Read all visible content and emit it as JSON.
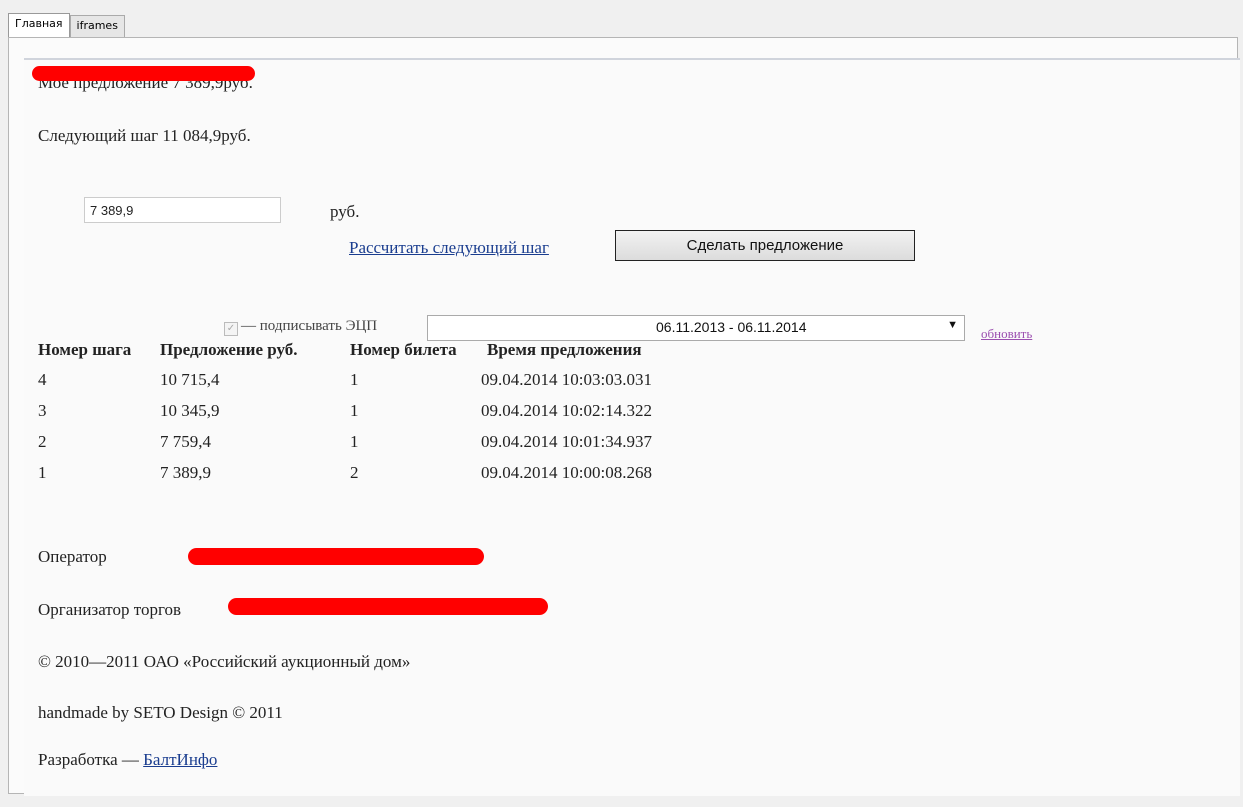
{
  "tabs": [
    {
      "label": "Главная",
      "active": true
    },
    {
      "label": "iframes",
      "active": false
    }
  ],
  "offer": {
    "my_offer": "Мое предложение 7 389,9руб.",
    "next_step": "Следующий шаг 11 084,9руб.",
    "amount_value": "7 389,9",
    "currency": "руб.",
    "calc_link": "Рассчитать следующий шаг",
    "submit_label": "Сделать предложение"
  },
  "signing": {
    "sign_label": "— подписывать ЭЦП",
    "sign_checked": true,
    "certificate_value": "06.11.2013 - 06.11.2014",
    "refresh_link": "обновить"
  },
  "bids": {
    "columns": [
      "Номер шага",
      "Предложение руб.",
      "Номер билета",
      "Время предложения"
    ],
    "rows": [
      [
        "4",
        "10 715,4",
        "1",
        "09.04.2014 10:03:03.031"
      ],
      [
        "3",
        "10 345,9",
        "1",
        "09.04.2014 10:02:14.322"
      ],
      [
        "2",
        "7 759,4",
        "1",
        "09.04.2014 10:01:34.937"
      ],
      [
        "1",
        "7 389,9",
        "2",
        "09.04.2014 10:00:08.268"
      ]
    ]
  },
  "footer": {
    "operator_label": "Оператор",
    "organizer_label": "Организатор торгов",
    "copyright": "© 2010—2011 ОАО «Российский аукционный дом»",
    "handmade": "handmade by SETO Design © 2011",
    "dev_label": "Разработка —",
    "dev_link": "БалтИнфо"
  },
  "colors": {
    "redaction": "#ff0000",
    "link": "#1a3d8f",
    "refresh_link": "#9b4fb0"
  }
}
